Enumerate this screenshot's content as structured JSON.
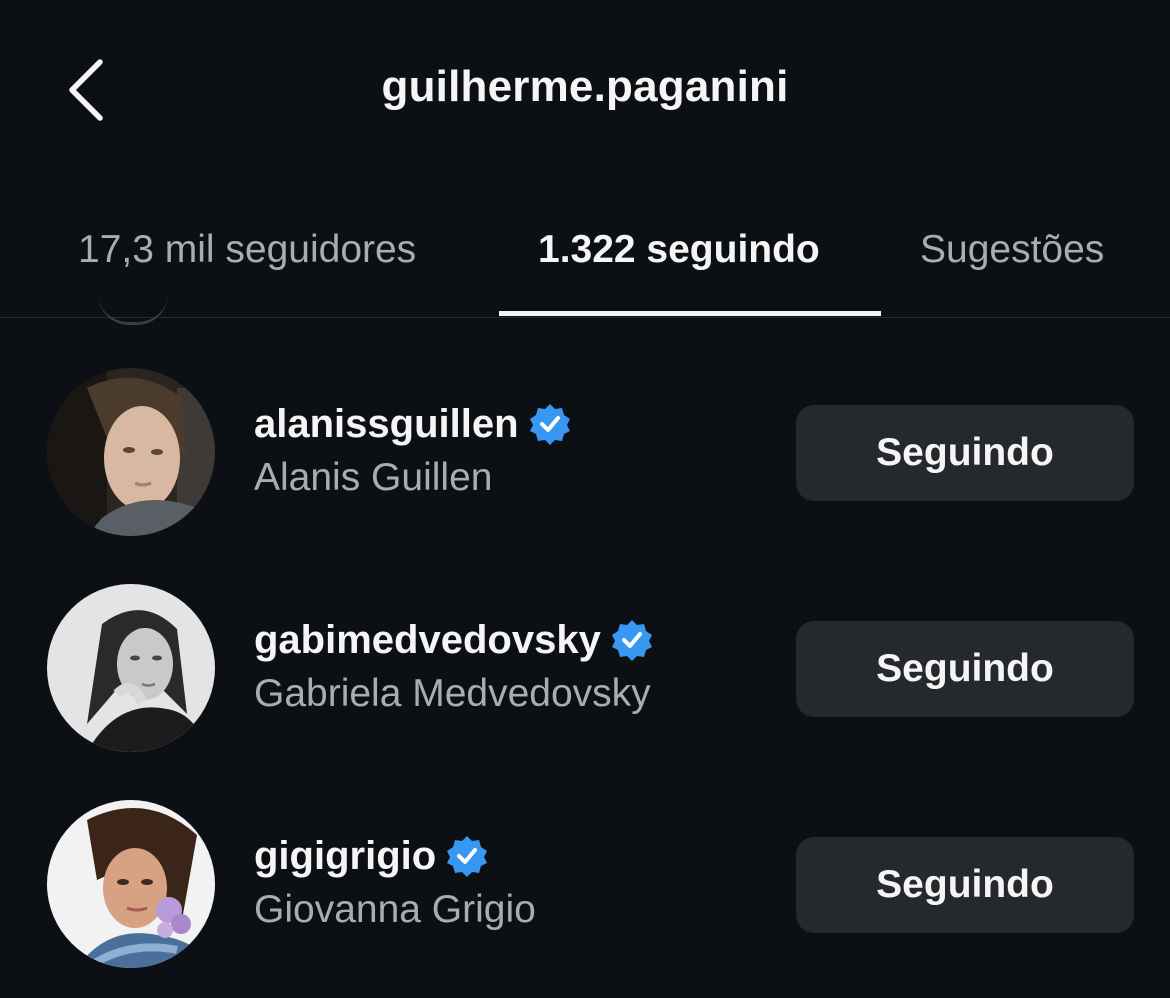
{
  "header": {
    "title": "guilherme.paganini",
    "back_icon": "chevron-left-icon"
  },
  "tabs": [
    {
      "label": "17,3 mil seguidores",
      "active": false
    },
    {
      "label": "1.322 seguindo",
      "active": true
    },
    {
      "label": "Sugestões",
      "active": false
    }
  ],
  "users": [
    {
      "username": "alanissguillen",
      "full_name": "Alanis Guillen",
      "verified": true,
      "button_label": "Seguindo"
    },
    {
      "username": "gabimedvedovsky",
      "full_name": "Gabriela Medvedovsky",
      "verified": true,
      "button_label": "Seguindo"
    },
    {
      "username": "gigigrigio",
      "full_name": "Giovanna Grigio",
      "verified": true,
      "button_label": "Seguindo"
    }
  ],
  "colors": {
    "background": "#0c1014",
    "text_primary": "#f5f5f5",
    "text_secondary": "#a8acb3",
    "button_bg": "#25292e",
    "verified_blue": "#3897f0"
  }
}
